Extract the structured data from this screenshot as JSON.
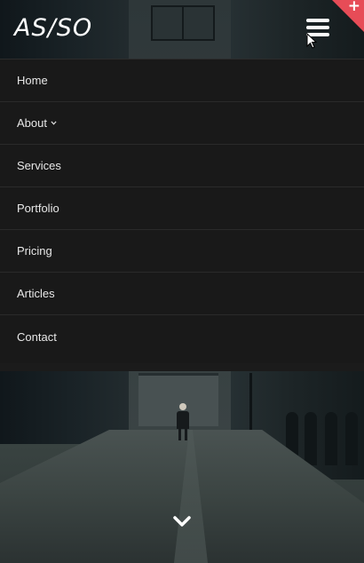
{
  "brand": {
    "logo_text": "AS/SO"
  },
  "header": {
    "menu_icon": "hamburger-icon",
    "corner_icon": "plus-icon",
    "corner_color": "#e74c57"
  },
  "menu": {
    "items": [
      {
        "label": "Home"
      },
      {
        "label": "About",
        "has_dropdown": true
      },
      {
        "label": "Services"
      },
      {
        "label": "Portfolio"
      },
      {
        "label": "Pricing"
      },
      {
        "label": "Articles"
      },
      {
        "label": "Contact"
      }
    ]
  },
  "hero": {
    "scroll_icon": "chevron-down-icon"
  }
}
